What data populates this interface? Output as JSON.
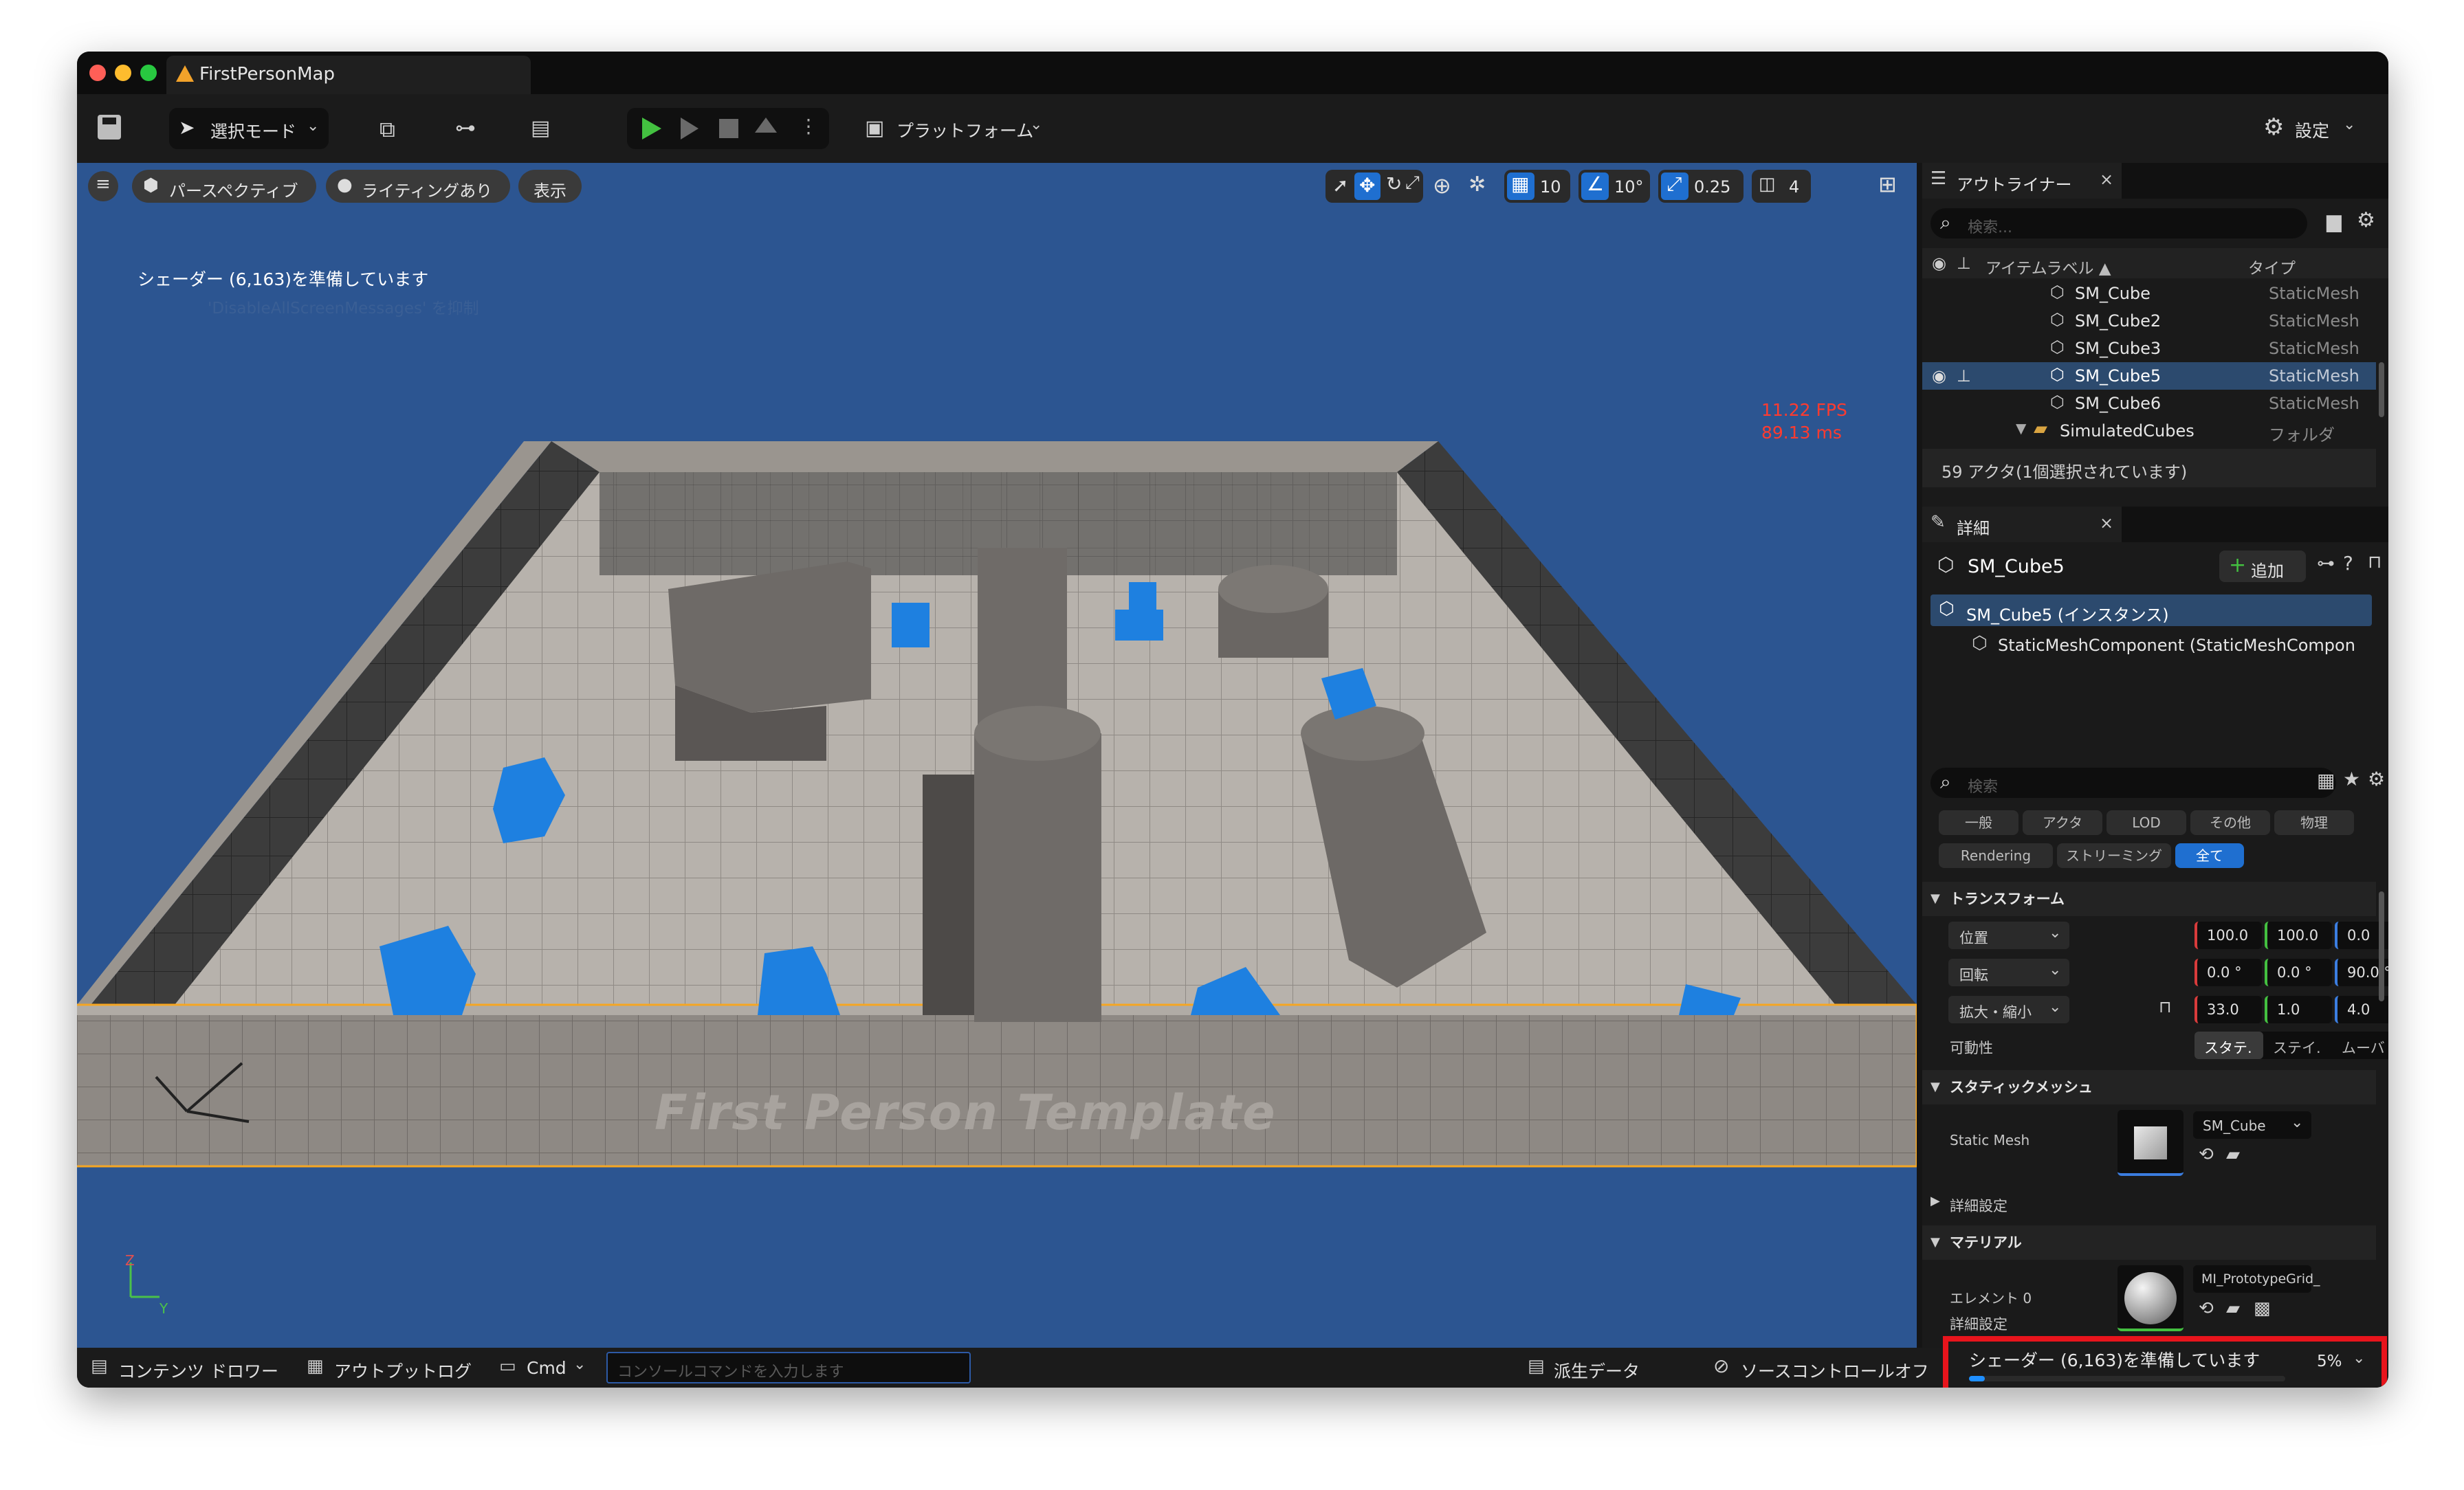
{
  "window": {
    "title": "FirstPersonMap"
  },
  "toolbar": {
    "select_mode": "選択モード",
    "platform": "プラットフォーム",
    "settings": "設定"
  },
  "viewport": {
    "perspective": "パースペクティブ",
    "lighting": "ライティングあり",
    "show": "表示",
    "shader_msg": "シェーダー (6,163)を準備しています",
    "suppress_msg": "'DisableAllScreenMessages' を抑制",
    "fps": "11.22 FPS",
    "ms": "89.13 ms",
    "grid_size": "10",
    "rot_snap": "10°",
    "scale_snap": "0.25",
    "cam_speed": "4",
    "floor_text": "First Person Template",
    "axis_z": "Z",
    "axis_y": "Y"
  },
  "outliner": {
    "tab": "アウトライナー",
    "search_placeholder": "検索...",
    "col_label": "アイテムラベル ▲",
    "col_type": "タイプ",
    "rows": [
      {
        "label": "SM_Cube",
        "type": "StaticMesh"
      },
      {
        "label": "SM_Cube2",
        "type": "StaticMesh"
      },
      {
        "label": "SM_Cube3",
        "type": "StaticMesh"
      },
      {
        "label": "SM_Cube5",
        "type": "StaticMesh"
      },
      {
        "label": "SM_Cube6",
        "type": "StaticMesh"
      },
      {
        "label": "SimulatedCubes",
        "type": "フォルダ"
      }
    ],
    "summary": "59 アクタ(1個選択されています)"
  },
  "details": {
    "tab": "詳細",
    "object_name": "SM_Cube5",
    "add": "追加",
    "instance": "SM_Cube5 (インスタンス)",
    "component": "StaticMeshComponent (StaticMeshCompon",
    "search_placeholder": "検索",
    "cats_row1": [
      "一般",
      "アクタ",
      "LOD",
      "その他",
      "物理"
    ],
    "cats_row2": [
      "Rendering",
      "ストリーミング",
      "全て"
    ],
    "transform": "トランスフォーム",
    "location": "位置",
    "rotation": "回転",
    "scale": "拡大・縮小",
    "loc_vals": [
      "100.0",
      "100.0",
      "0.0"
    ],
    "rot_vals": [
      "0.0 °",
      "0.0 °",
      "90.0 °"
    ],
    "scale_vals": [
      "33.0",
      "1.0",
      "4.0"
    ],
    "mobility": "可動性",
    "mobility_opts": [
      "スタテ.",
      "ステイ.",
      "ムーバ"
    ],
    "static_mesh_section": "スタティックメッシュ",
    "static_mesh_label": "Static Mesh",
    "static_mesh_value": "SM_Cube",
    "advanced": "詳細設定",
    "material_section": "マテリアル",
    "element0": "エレメント 0",
    "material_value": "MI_PrototypeGrid_",
    "advanced2": "詳細設定"
  },
  "statusbar": {
    "content_drawer": "コンテンツ ドロワー",
    "output_log": "アウトプットログ",
    "cmd": "Cmd",
    "console_placeholder": "コンソールコマンドを入力します",
    "derived_data": "派生データ",
    "source_control": "ソースコントロールオフ",
    "shader_progress": "シェーダー (6,163)を準備しています",
    "shader_percent": "5%",
    "progress": 0.05
  },
  "colors": {
    "accent_blue": "#1f6fd0",
    "play_green": "#43c040",
    "highlight_red": "#e8141c",
    "viewport_bg": "#2c5591"
  }
}
